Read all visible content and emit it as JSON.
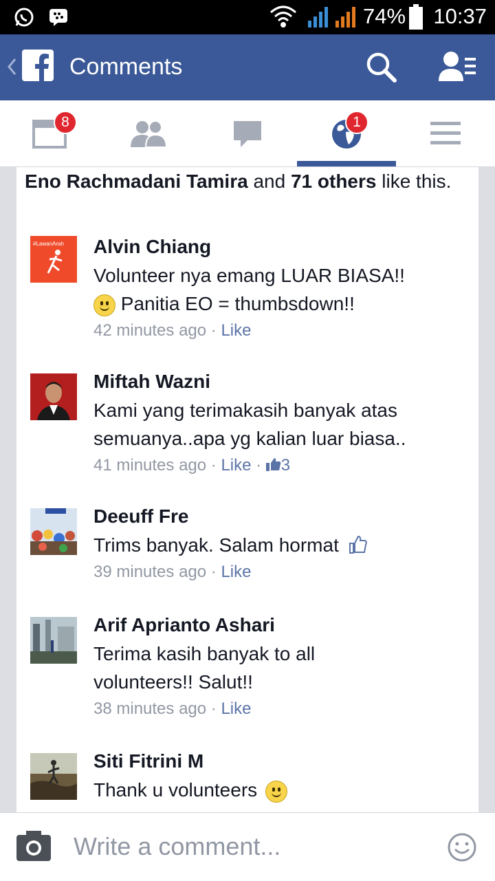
{
  "status_bar": {
    "battery_percent": "74%",
    "time": "10:37",
    "icons": [
      "whatsapp-icon",
      "bbm-icon",
      "wifi-icon",
      "signal-icon",
      "signal-icon",
      "battery-icon"
    ]
  },
  "app_bar": {
    "title": "Comments",
    "icons": [
      "back-icon",
      "facebook-logo-icon",
      "search-icon",
      "friend-requests-icon"
    ],
    "brand_color": "#3b5998"
  },
  "nav_tabs": [
    {
      "name": "news-feed",
      "icon": "newsfeed-icon",
      "badge": "8"
    },
    {
      "name": "friends",
      "icon": "friends-icon",
      "badge": ""
    },
    {
      "name": "messages",
      "icon": "messages-icon",
      "badge": ""
    },
    {
      "name": "notifications",
      "icon": "globe-icon",
      "badge": "1",
      "active": true
    },
    {
      "name": "more",
      "icon": "menu-icon",
      "badge": ""
    }
  ],
  "likes_summary": {
    "name": "Eno Rachmadani Tamira",
    "connector": " and ",
    "others": "71 others",
    "suffix": " like this."
  },
  "comments": [
    {
      "author": "Alvin Chiang",
      "text_line1": "Volunteer nya emang LUAR BIASA!!",
      "text_line2": " Panitia EO = thumbsdown!!",
      "time": "42 minutes ago",
      "like_label": "Like",
      "likes": ""
    },
    {
      "author": "Miftah Wazni",
      "text_line1": "Kami yang terimakasih banyak atas",
      "text_line2": "semuanya..apa yg kalian luar biasa..",
      "time": "41 minutes ago",
      "like_label": "Like",
      "likes": "3"
    },
    {
      "author": "Deeuff Fre",
      "text_line1": "Trims banyak. Salam hormat",
      "text_line2": "",
      "time": "39 minutes ago",
      "like_label": "Like",
      "likes": ""
    },
    {
      "author": "Arif Aprianto Ashari",
      "text_line1": "Terima kasih banyak to all",
      "text_line2": "volunteers!! Salut!!",
      "time": "38 minutes ago",
      "like_label": "Like",
      "likes": ""
    },
    {
      "author": "Siti Fitrini M",
      "text_line1": "Thank u volunteers",
      "text_line2": "",
      "time": "",
      "like_label": "",
      "likes": ""
    }
  ],
  "avatar1_text": "#LawanArah",
  "composer": {
    "placeholder": "Write a comment..."
  },
  "separator": " · "
}
